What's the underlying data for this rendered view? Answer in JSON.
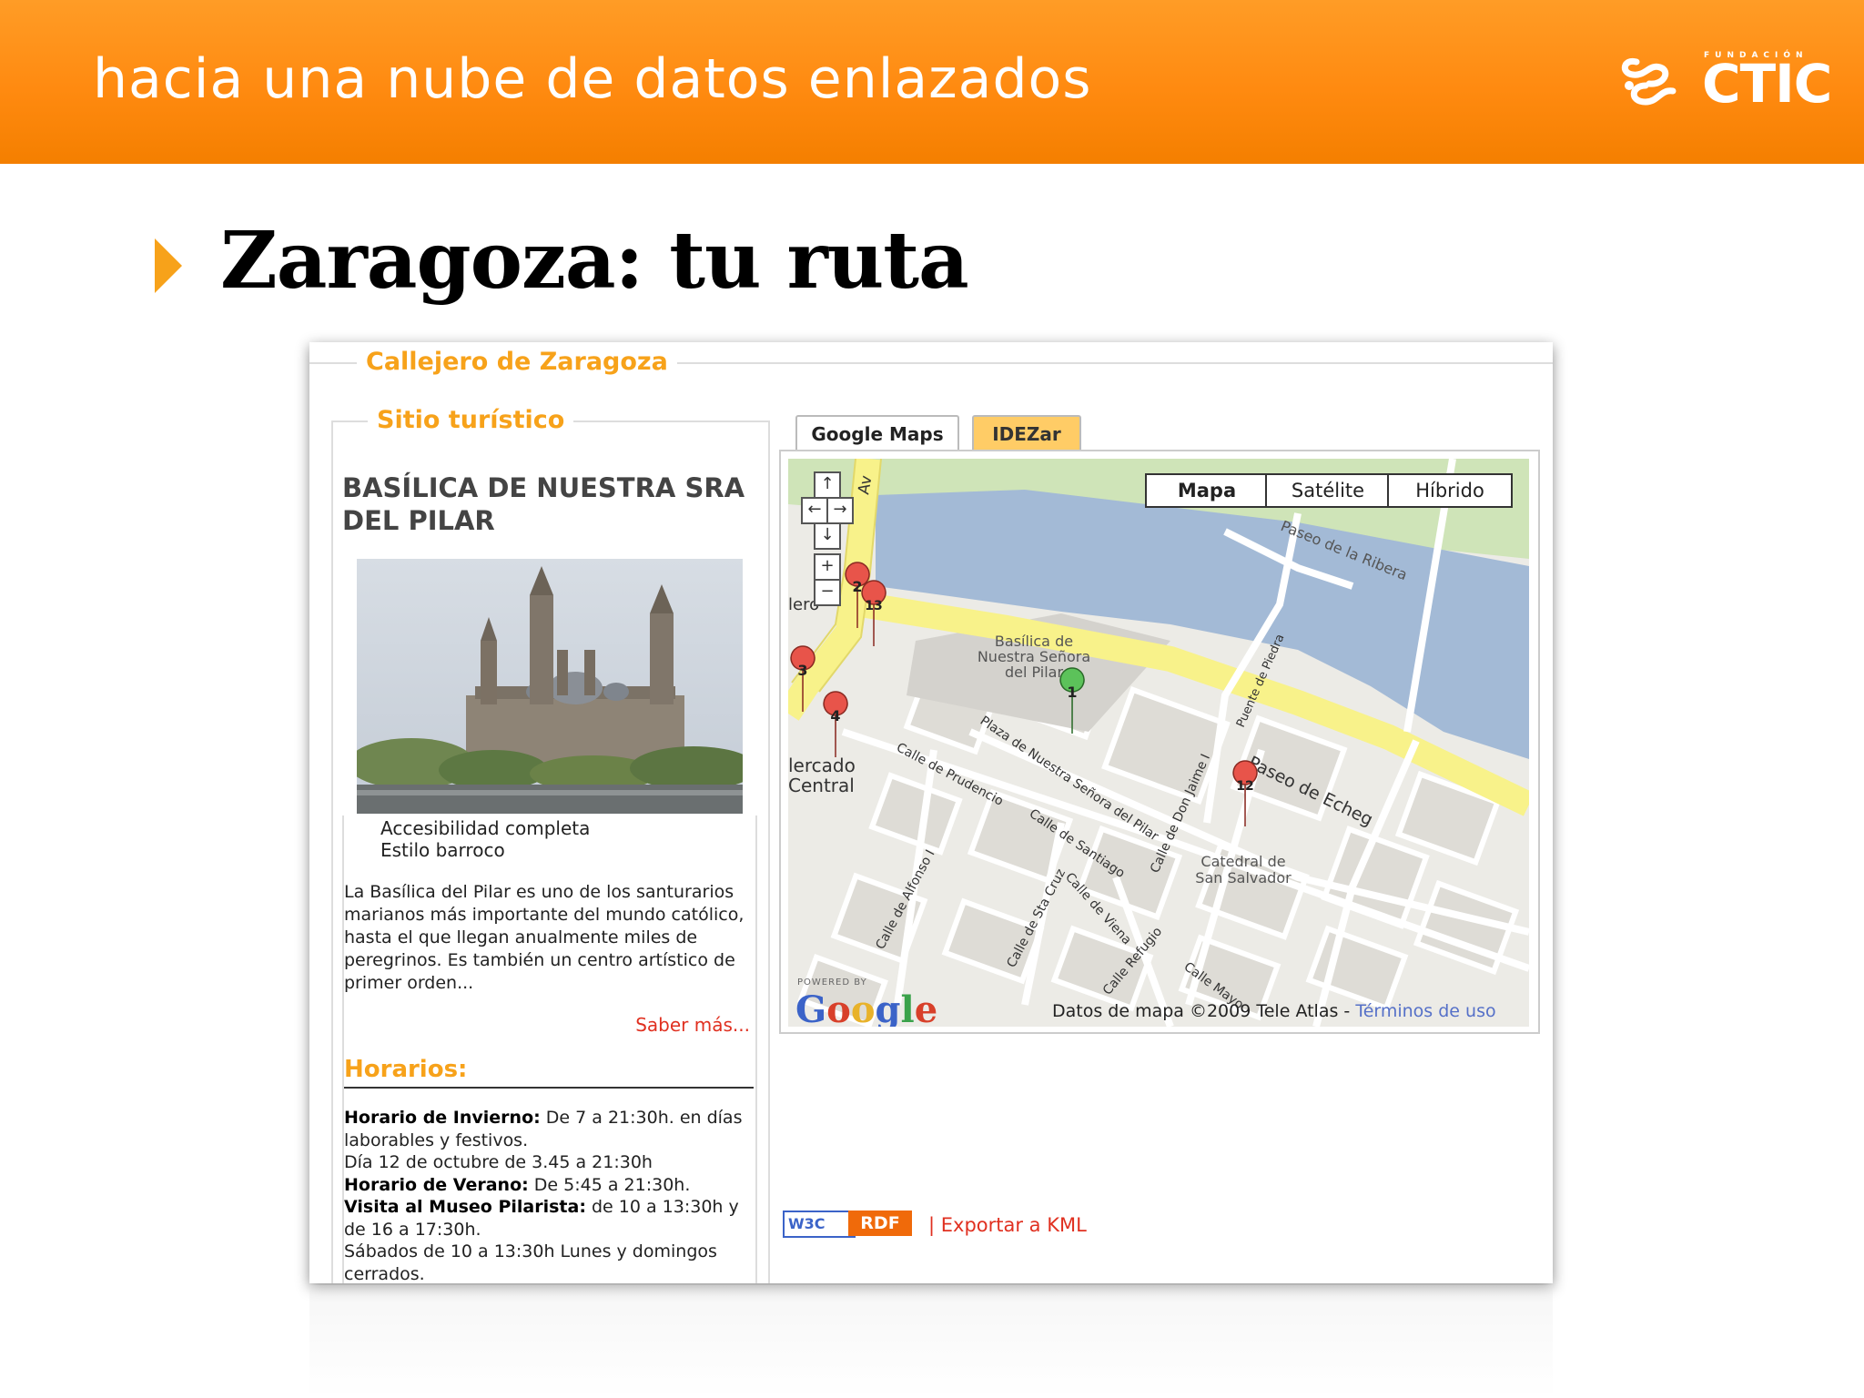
{
  "slide": {
    "title": "hacia una nube de datos enlazados",
    "logo_text": "CTIC",
    "logo_small_text": "FUNDACIÓN",
    "heading": "Zaragoza: tu ruta"
  },
  "app": {
    "legend_main": "Callejero de Zaragoza",
    "legend_sub": "Sitio turístico",
    "site_title": "BASÍLICA DE NUESTRA SRA DEL PILAR",
    "accessibility": "Accesibilidad completa",
    "style": "Estilo barroco",
    "description": "La Basílica del Pilar es uno de los santurarios marianos más importante del mundo católico, hasta el que llegan anualmente miles de peregrinos. Es también un centro artístico de primer orden...",
    "more_link": "Saber más...",
    "hours_title": "Horarios:",
    "hours": {
      "winter_label": "Horario de Invierno:",
      "winter_text": " De 7 a 21:30h. en días laborables y festivos.",
      "oct_text": "Día 12 de octubre de 3.45 a 21:30h",
      "summer_label": "Horario de Verano:",
      "summer_text": " De 5:45 a 21:30h.",
      "museum_label": "Visita al Museo Pilarista:",
      "museum_text": " de 10 a 13:30h y de 16 a 17:30h.",
      "weekend_text": "Sábados de 10 a 13:30h Lunes y domingos cerrados."
    },
    "tabs": [
      {
        "label": "Google Maps",
        "active": true
      },
      {
        "label": "IDEZar",
        "active": false
      }
    ],
    "map_types": [
      "Mapa",
      "Satélite",
      "Híbrido"
    ],
    "selected_map_type": "Mapa",
    "map_labels": {
      "basilica": [
        "Basílica de",
        "Nuestra Señora",
        "del Pilar"
      ],
      "catedral": [
        "Catedral de",
        "San Salvador"
      ],
      "mercado": [
        "lercado",
        "Central"
      ],
      "lero": "lero",
      "paseo_ribera": "Paseo de la Ribera",
      "paseo_echeg": "Paseo de Echeg",
      "plaza": "Plaza de Nuestra Señora del Pilar",
      "calle_prudencio": "Calle de Prudencio",
      "calle_santiago": "Calle de Santiago",
      "calle_viena": "Calle de Viena",
      "calle_sta_cruz": "Calle de Sta Cruz",
      "calle_alfonso": "Calle de Alfonso I",
      "calle_don_jaime": "Calle de Don Jaime I",
      "calle_refugio": "Calle Refugio",
      "calle_mayor": "Calle Mayo",
      "puente_piedra": "Puente de Piedra",
      "av": "Av"
    },
    "markers": [
      {
        "label": "1",
        "color": "#5cc25a"
      },
      {
        "label": "2",
        "color": "#e8544a"
      },
      {
        "label": "13",
        "color": "#e8544a"
      },
      {
        "label": "3",
        "color": "#e8544a"
      },
      {
        "label": "4",
        "color": "#e8544a"
      },
      {
        "label": "12",
        "color": "#e8544a"
      }
    ],
    "nav_icons": [
      "pan-up-icon",
      "pan-left-icon",
      "pan-right-icon",
      "pan-down-icon",
      "zoom-in-icon",
      "zoom-out-icon"
    ],
    "powered_by": "POWERED BY",
    "google": "Google",
    "copyright": "Datos de mapa ©2009 Tele Atlas - ",
    "terms": "Términos de uso",
    "w3c": "W3C",
    "rdf": "RDF",
    "export": "| Exportar a KML"
  },
  "colors": {
    "orange": "#ff8a10",
    "accent": "#f7a21a",
    "water": "#99b3cc",
    "major_road": "#f8f28a",
    "park": "#cde6b4"
  }
}
